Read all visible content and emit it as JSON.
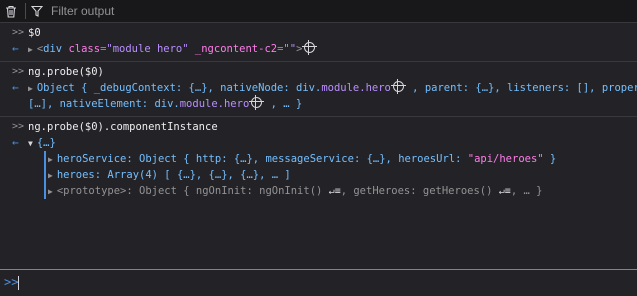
{
  "toolbar": {
    "filter_placeholder": "Filter output"
  },
  "entries": {
    "e1_cmd": "$0",
    "e1_ret_open": "<",
    "e1_tag": "div",
    "e1_attr1": "class",
    "e1_val1": "\"module hero\"",
    "e1_attr2": "_ngcontent-c2",
    "e1_val2": "\"\"",
    "e1_ret_close": ">",
    "e2_cmd": "ng.probe($0)",
    "e2_l1_a": "Object { _debugContext: {…}, nativeNode: ",
    "e2_l1_node": "div.",
    "e2_l1_cls": "module.hero",
    "e2_l1_b": " , parent: {…}, listeners: [], properties",
    "e2_l2_a": "[…], nativeElement: ",
    "e2_l2_node": "div.",
    "e2_l2_cls": "module.hero",
    "e2_l2_b": " , … }",
    "e3_cmd": "ng.probe($0).componentInstance",
    "e3_root": "{…}",
    "e3_p1_key": "heroService",
    "e3_p1_val": ": Object { http: {…}, messageService: {…}, heroesUrl: ",
    "e3_p1_str": "\"api/heroes\"",
    "e3_p1_end": " }",
    "e3_p2_key": "heroes",
    "e3_p2_val": ": Array(4) [ {…}, {…}, {…}, … ]",
    "e3_p3_key": "<prototype>",
    "e3_p3_val_a": ": Object { ngOnInit: ngOnInit() ",
    "e3_p3_val_b": ", getHeroes: getHeroes() ",
    "e3_p3_val_c": ", … }"
  },
  "icons": {
    "trash": "trash-icon",
    "filter": "filter-icon",
    "prompt": "prompt-icon"
  }
}
